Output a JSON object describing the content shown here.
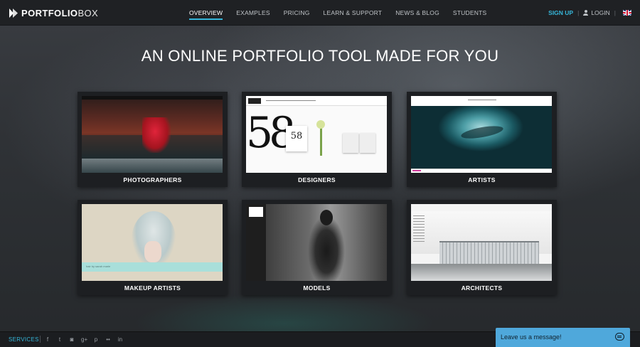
{
  "brand": {
    "logo_text": "PORTFOLIO",
    "logo_text_thin": "BOX"
  },
  "nav": {
    "items": [
      {
        "label": "OVERVIEW",
        "active": true
      },
      {
        "label": "EXAMPLES"
      },
      {
        "label": "PRICING"
      },
      {
        "label": "LEARN & SUPPORT"
      },
      {
        "label": "NEWS & BLOG"
      },
      {
        "label": "STUDENTS"
      }
    ],
    "signup": "SIGN UP",
    "login": "LOGIN",
    "language_icon": "uk-flag-icon"
  },
  "hero": {
    "title": "AN ONLINE PORTFOLIO TOOL MADE FOR YOU"
  },
  "categories": [
    {
      "label": "PHOTOGRAPHERS"
    },
    {
      "label": "DESIGNERS"
    },
    {
      "label": "ARTISTS"
    },
    {
      "label": "MAKEUP ARTISTS"
    },
    {
      "label": "MODELS"
    },
    {
      "label": "ARCHITECTS"
    }
  ],
  "thumbs": {
    "design_number": "58",
    "makeup_band": "hair by sarah marie"
  },
  "footer": {
    "services": "SERVICES",
    "social": [
      "f",
      "t",
      "◙",
      "g+",
      "p",
      "••",
      "in"
    ]
  },
  "chat": {
    "label": "Leave us a message!"
  },
  "colors": {
    "accent": "#36b6d9",
    "chat": "#4fa8db",
    "header": "#1f2124"
  }
}
